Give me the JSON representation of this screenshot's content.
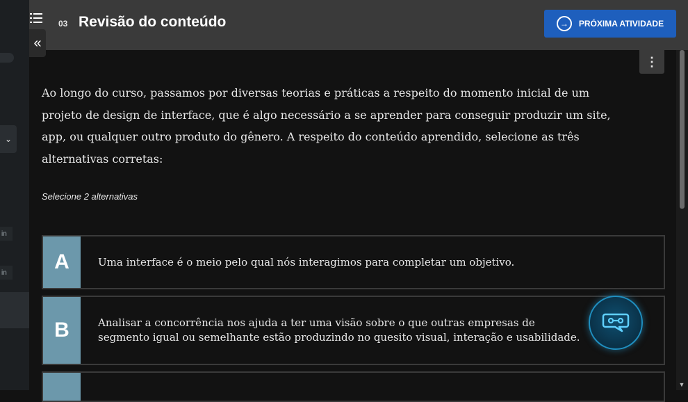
{
  "header": {
    "lesson_number": "03",
    "lesson_title": "Revisão do conteúdo",
    "next_button_label": "PRÓXIMA ATIVIDADE"
  },
  "sidebar": {
    "tag_1": "in",
    "tag_2": "in"
  },
  "question": {
    "text": "Ao longo do curso, passamos por diversas teorias e práticas a respeito do momento inicial de um projeto de design de interface, que é algo necessário a se aprender para conseguir produzir um site, app, ou qualquer outro produto do gênero. A respeito do conteúdo aprendido, selecione as três alternativas corretas:",
    "hint": "Selecione 2 alternativas"
  },
  "alternatives": [
    {
      "letter": "A",
      "text": "Uma interface é o meio pelo qual nós interagimos para completar um objetivo."
    },
    {
      "letter": "B",
      "text": "Analisar a concorrência nos ajuda a ter uma visão sobre o que outras empresas de segmento igual ou semelhante estão produzindo no quesito visual, interação e usabilidade."
    },
    {
      "letter": "",
      "text": ""
    }
  ],
  "icons": {
    "menu": "list-icon",
    "collapse": "double-chevron-left-icon",
    "next": "arrow-right-circle-icon",
    "kebab": "more-vertical-icon",
    "chat": "chatbot-icon"
  },
  "colors": {
    "primary_button": "#1e5fbd",
    "alternative_letter_bg": "#6c98ab",
    "chat_glow": "#1f8fc0"
  }
}
